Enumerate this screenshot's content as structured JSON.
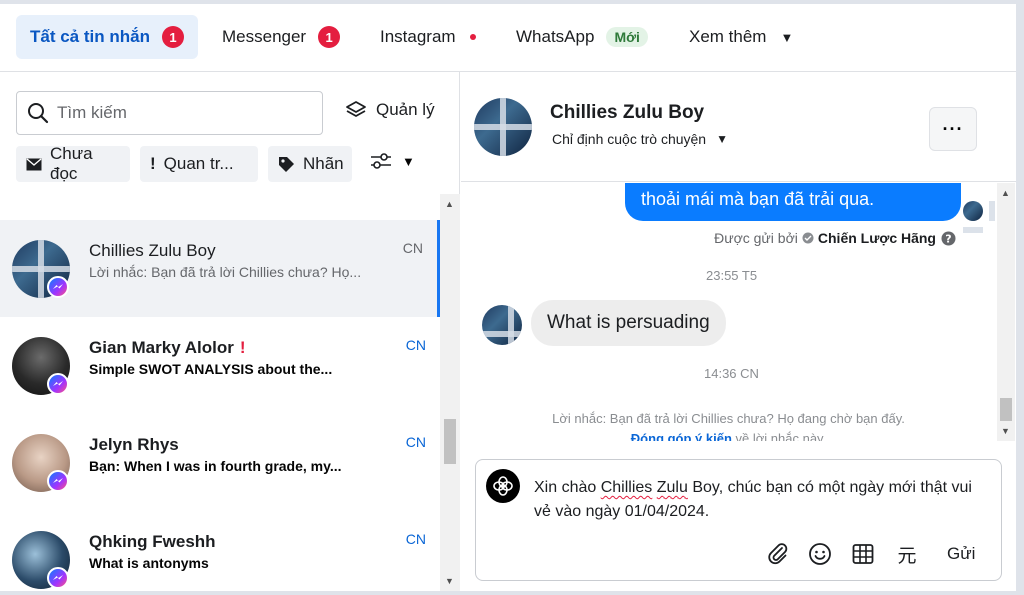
{
  "tabs": [
    {
      "label": "Tất cả tin nhắn",
      "badge": "1"
    },
    {
      "label": "Messenger",
      "badge": "1"
    },
    {
      "label": "Instagram"
    },
    {
      "label": "WhatsApp",
      "tag": "Mới"
    },
    {
      "label": "Xem thêm"
    }
  ],
  "sidebar": {
    "search_placeholder": "Tìm kiếm",
    "manage_label": "Quản lý",
    "filters": [
      "Chưa đọc",
      "Quan tr...",
      "Nhãn"
    ]
  },
  "conversations": [
    {
      "name": "Chillies Zulu Boy",
      "snippet": "Lời nhắc: Bạn đã trả lời Chillies chưa? Họ...",
      "time": "CN"
    },
    {
      "name": "Gian Marky Alolor",
      "flag": "!",
      "snippet": "Simple SWOT ANALYSIS about the...",
      "time": "CN"
    },
    {
      "name": "Jelyn Rhys",
      "snippet": "Bạn: When I was in fourth grade, my...",
      "time": "CN"
    },
    {
      "name": "Qhking Fweshh",
      "snippet": "What is antonyms",
      "time": "CN"
    }
  ],
  "conversation": {
    "name": "Chillies Zulu Boy",
    "assign_label": "Chỉ định cuộc trò chuyện",
    "more_label": "···",
    "outgoing_text": "thoải mái mà bạn đã trải qua.",
    "sent_by_prefix": "Được gửi bởi",
    "sent_by_name": "Chiến Lược Hãng",
    "time_1": "23:55 T5",
    "incoming_text": "What is persuading",
    "time_2": "14:36 CN",
    "reminder_line1": "Lời nhắc: Bạn đã trả lời Chillies chưa? Họ đang chờ bạn đấy.",
    "reminder_link": "Đóng góp ý kiến",
    "reminder_line2_rest": " về lời nhắc này."
  },
  "composer": {
    "draft_before": "Xin chào ",
    "draft_name_1": "Chillies",
    "draft_space": " ",
    "draft_name_2": "Zulu",
    "draft_after": " Boy, chúc bạn có một ngày mới thật vui vẻ vào ngày 01/04/2024.",
    "yuan_symbol": "元",
    "send_label": "Gửi"
  },
  "colors": {
    "accent": "#1877f2",
    "outgoing_bubble": "#0a7cff",
    "badge": "#e41e3f",
    "active_tab_bg": "#e7f0fb"
  }
}
